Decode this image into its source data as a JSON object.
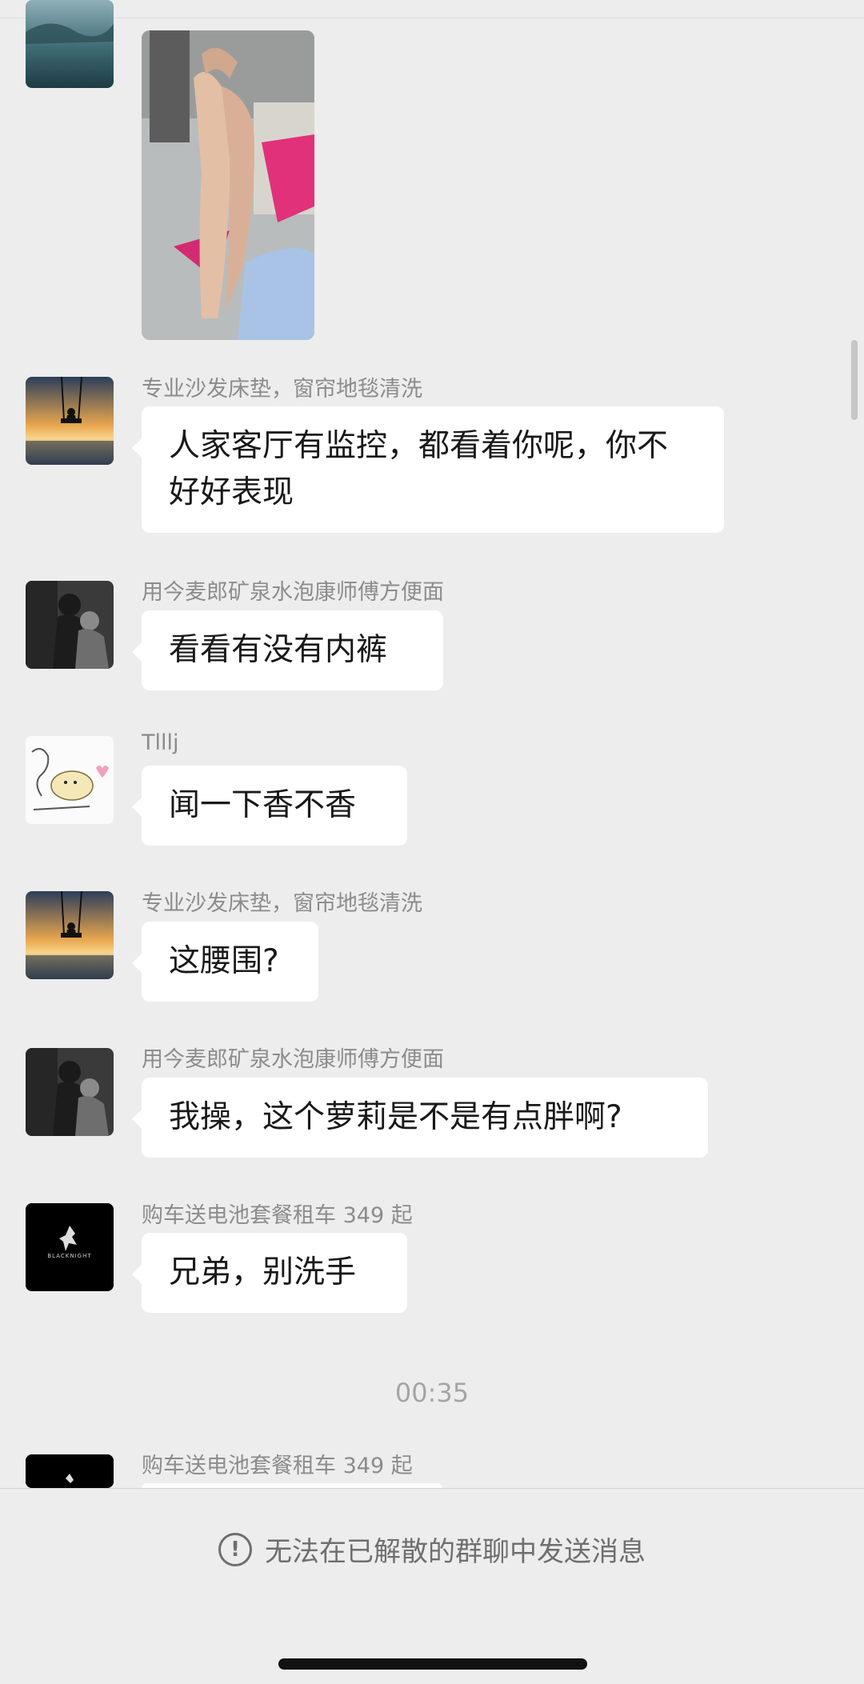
{
  "messages": [
    {
      "sender": "专业沙发床垫，窗帘地毯清洗",
      "text": "人家客厅有监控，都看着你呢，你不好好表现"
    },
    {
      "sender": "用今麦郎矿泉水泡康师傅方便面",
      "text": "看看有没有内裤"
    },
    {
      "sender": "Tlllj",
      "text": "闻一下香不香"
    },
    {
      "sender": "专业沙发床垫，窗帘地毯清洗",
      "text": "这腰围?"
    },
    {
      "sender": "用今麦郎矿泉水泡康师傅方便面",
      "text": "我操，这个萝莉是不是有点胖啊?"
    },
    {
      "sender": "购车送电池套餐租车 349 起",
      "text": "兄弟，别洗手"
    }
  ],
  "timestamp": "00:35",
  "last_sender": "购车送电池套餐租车 349 起",
  "footer": {
    "notice": "无法在已解散的群聊中发送消息",
    "icon": "!"
  },
  "avatar_logo_text": "BLACKNIGHT",
  "colors": {
    "background": "#ededed",
    "bubble": "#ffffff",
    "text": "#191919",
    "meta": "#8c8c8c"
  }
}
